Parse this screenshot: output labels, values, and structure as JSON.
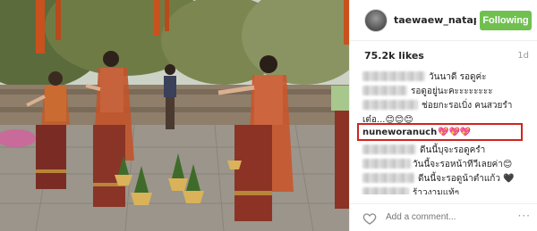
{
  "post": {
    "username": "taewaew_natap...",
    "follow_label": "Following",
    "likes": "75.2k likes",
    "age": "1d"
  },
  "comments": [
    {
      "text": "วันนาดี รอดูค่ะ"
    },
    {
      "text": "รอดูอยู่นะคะะะะะะะะ"
    },
    {
      "text": "ช่อยกะรอเบิ่ง คนสวยรำ"
    },
    {
      "text": "เต๋อ...😊😊😊"
    },
    {
      "user": "nuneworanuch",
      "text": "💖💖💖"
    },
    {
      "text": "ดีนนี้บุจะรอดูครำ"
    },
    {
      "text": "วันนี้จะรอหน้าทีวีเลยค่า😊"
    },
    {
      "text": "ดีนนี้จะรอดูน้าตำแก้ว 🖤"
    },
    {
      "text": "ร้าวงามแท้ๆ"
    }
  ],
  "footer": {
    "add_comment_placeholder": "Add a comment...",
    "more_label": "···"
  },
  "colors": {
    "follow_button": "#70c050",
    "highlight_box": "#d0241f"
  },
  "icons": [
    "heart-icon",
    "more-options-icon"
  ]
}
